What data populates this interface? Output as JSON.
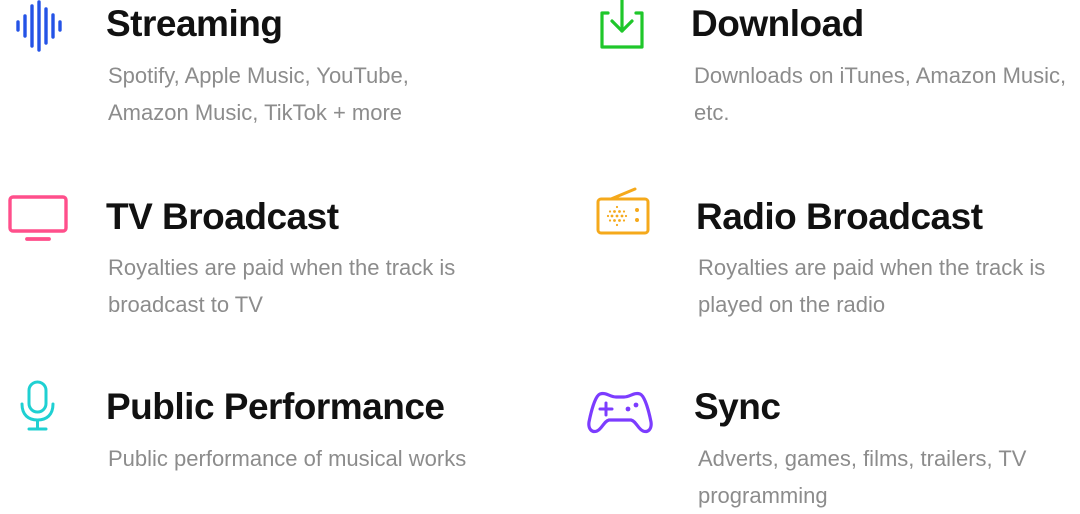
{
  "features": [
    {
      "id": "streaming",
      "title": "Streaming",
      "description": "Spotify, Apple Music, YouTube, Amazon Music, TikTok + more",
      "icon": "sound-wave-icon",
      "color": "#2453e6"
    },
    {
      "id": "download",
      "title": "Download",
      "description": "Downloads on iTunes, Amazon Music, etc.",
      "icon": "download-icon",
      "color": "#1fc72a"
    },
    {
      "id": "tv",
      "title": "TV Broadcast",
      "description": "Royalties are paid when the track is broadcast to TV",
      "icon": "tv-icon",
      "color": "#ff4f8b"
    },
    {
      "id": "radio",
      "title": "Radio Broadcast",
      "description": "Royalties are paid when the track is played on the radio",
      "icon": "radio-icon",
      "color": "#f5a91b"
    },
    {
      "id": "public",
      "title": "Public Performance",
      "description": "Public performance of musical works",
      "icon": "microphone-icon",
      "color": "#1fd0d2"
    },
    {
      "id": "sync",
      "title": "Sync",
      "description": "Adverts, games, films, trailers, TV programming",
      "icon": "game-controller-icon",
      "color": "#7c3cff"
    }
  ]
}
